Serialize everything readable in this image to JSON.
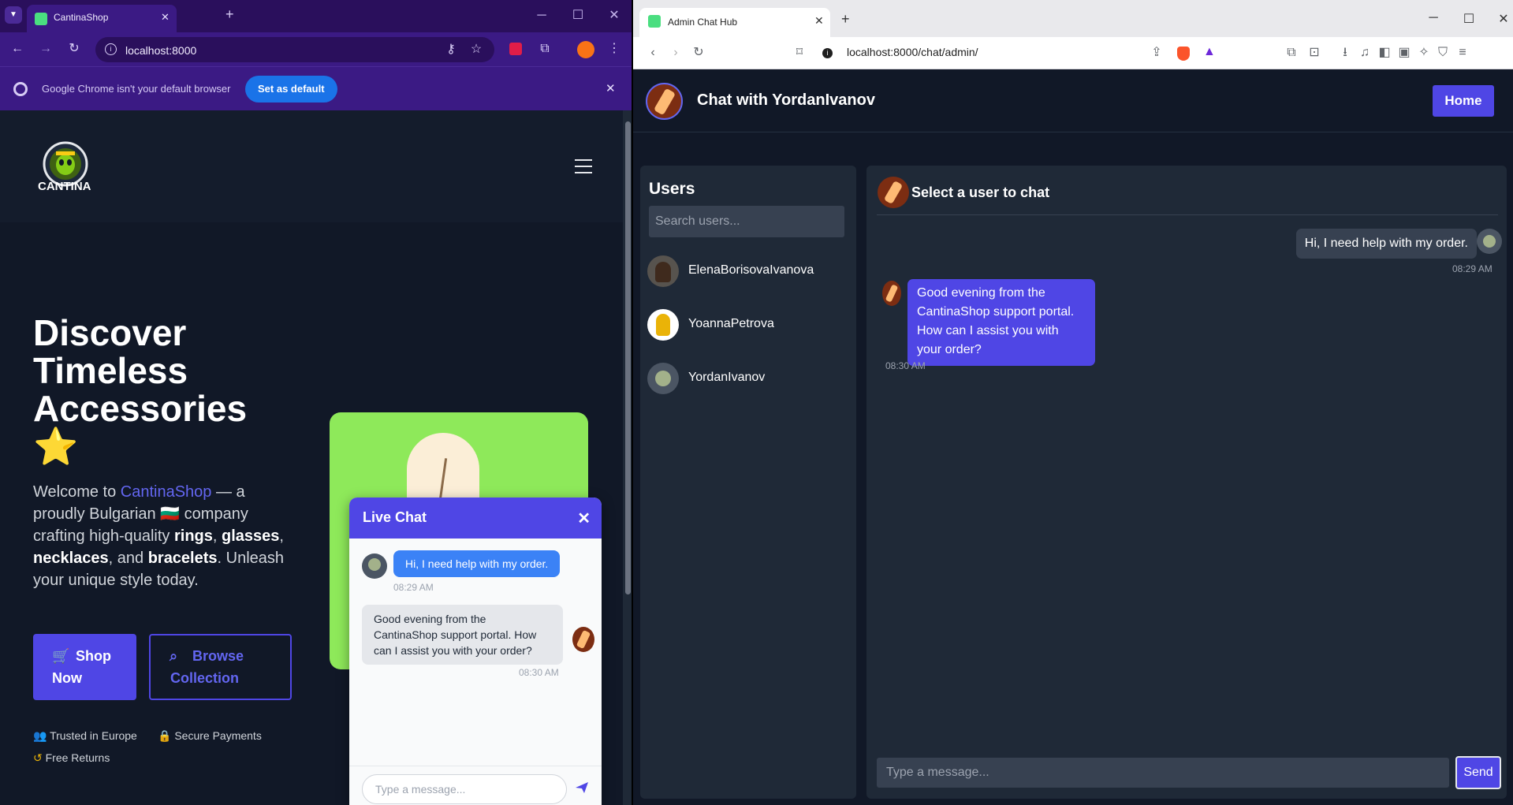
{
  "left_browser": {
    "tab_title": "CantinaShop",
    "new_tab": "+",
    "address": "localhost:8000",
    "infobar_text": "Google Chrome isn't your default browser",
    "set_default_label": "Set as default"
  },
  "shop": {
    "logo_text": "CANTINA",
    "hero_title_line1": "Discover",
    "hero_title_line2": "Timeless",
    "hero_title_line3": "Accessories",
    "hero_star": "⭐",
    "desc_1": "Welcome to ",
    "desc_brand": "CantinaShop",
    "desc_2": " — a proudly Bulgarian ",
    "desc_flag": "🇧🇬",
    "desc_3": " company crafting high-quality ",
    "desc_rings": "rings",
    "desc_4": ", ",
    "desc_glasses": "glasses",
    "desc_5": ", ",
    "desc_necklaces": "necklaces",
    "desc_6": ", and ",
    "desc_bracelets": "bracelets",
    "desc_7": ". Unleash your unique style today.",
    "shop_now_1": "Shop",
    "shop_now_2": "Now",
    "browse_1": "Browse",
    "browse_2": "Collection",
    "trust_europe": "Trusted in Europe",
    "trust_payments": "Secure Payments",
    "trust_returns": "Free Returns"
  },
  "live_chat": {
    "title": "Live Chat",
    "close": "✕",
    "user_msg": "Hi, I need help with my order.",
    "user_time": "08:29 AM",
    "bot_msg": "Good evening from the CantinaShop support portal. How can I assist you with your order?",
    "bot_time": "08:30 AM",
    "input_placeholder": "Type a message..."
  },
  "right_browser": {
    "tab_title": "Admin Chat Hub",
    "new_tab": "+",
    "address": "localhost:8000/chat/admin/"
  },
  "admin": {
    "header_title": "Chat with YordanIvanov",
    "home_label": "Home",
    "users_heading": "Users",
    "search_placeholder": "Search users...",
    "users": [
      {
        "name": "ElenaBorisovaIvanova"
      },
      {
        "name": "YoannaPetrova"
      },
      {
        "name": "YordanIvanov"
      }
    ],
    "chat_heading": "Select a user to chat",
    "user_msg": "Hi, I need help with my order.",
    "user_time": "08:29 AM",
    "bot_msg": "Good evening from the CantinaShop support portal. How can I assist you with your order?",
    "bot_time": "08:30 AM",
    "input_placeholder": "Type a message...",
    "send_label": "Send"
  },
  "colors": {
    "accent": "#4f46e5",
    "page_bg": "#111827",
    "panel_bg": "#1f2937",
    "chrome_purple": "#3b1a84"
  }
}
